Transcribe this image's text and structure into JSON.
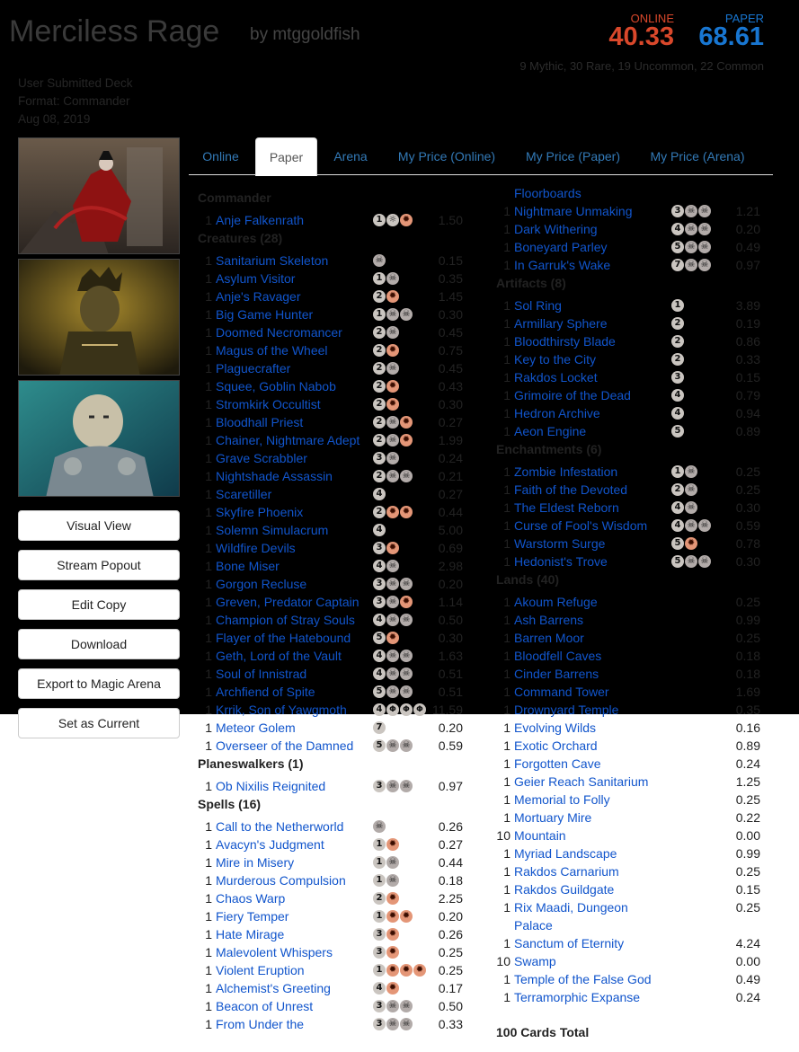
{
  "deck": {
    "title": "Merciless Rage",
    "byline": "by mtggoldfish",
    "submitted": "User Submitted Deck",
    "format": "Format: Commander",
    "date": "Aug 08, 2019"
  },
  "prices": {
    "online_label": "ONLINE",
    "online_value": "40.33",
    "paper_label": "PAPER",
    "paper_value": "68.61",
    "counts": "9 Mythic, 30 Rare, 19 Uncommon, 22 Common"
  },
  "colors": {
    "online": "#d9482b",
    "paper": "#1876d1",
    "link": "#1155cc",
    "white_pip": "#cac5c0",
    "black_pip": "#b2aba9",
    "red_pip": "#e49677"
  },
  "buttons": [
    "Visual View",
    "Stream Popout",
    "Edit Copy",
    "Download",
    "Export to Magic Arena",
    "Set as Current"
  ],
  "tabs": [
    "Online",
    "Paper",
    "Arena",
    "My Price (Online)",
    "My Price (Paper)",
    "My Price (Arena)"
  ],
  "active_tab": "Paper",
  "left": [
    {
      "sec": "Commander"
    },
    {
      "q": "1",
      "n": "Anje Falkenrath",
      "m": "1WR",
      "p": "1.50"
    },
    {
      "sec": "Creatures (28)"
    },
    {
      "q": "1",
      "n": "Sanitarium Skeleton",
      "m": "B",
      "p": "0.15"
    },
    {
      "q": "1",
      "n": "Asylum Visitor",
      "m": "1B",
      "p": "0.35"
    },
    {
      "q": "1",
      "n": "Anje's Ravager",
      "m": "2R",
      "p": "1.45"
    },
    {
      "q": "1",
      "n": "Big Game Hunter",
      "m": "1BB",
      "p": "0.30"
    },
    {
      "q": "1",
      "n": "Doomed Necromancer",
      "m": "2B",
      "p": "0.45"
    },
    {
      "q": "1",
      "n": "Magus of the Wheel",
      "m": "2R",
      "p": "0.75"
    },
    {
      "q": "1",
      "n": "Plaguecrafter",
      "m": "2B",
      "p": "0.45"
    },
    {
      "q": "1",
      "n": "Squee, Goblin Nabob",
      "m": "2R",
      "p": "0.43"
    },
    {
      "q": "1",
      "n": "Stromkirk Occultist",
      "m": "2R",
      "p": "0.30"
    },
    {
      "q": "1",
      "n": "Bloodhall Priest",
      "m": "2BR",
      "p": "0.27"
    },
    {
      "q": "1",
      "n": "Chainer, Nightmare Adept",
      "m": "2BR",
      "p": "1.99"
    },
    {
      "q": "1",
      "n": "Grave Scrabbler",
      "m": "3B",
      "p": "0.24"
    },
    {
      "q": "1",
      "n": "Nightshade Assassin",
      "m": "2BB",
      "p": "0.21"
    },
    {
      "q": "1",
      "n": "Scaretiller",
      "m": "4",
      "p": "0.27"
    },
    {
      "q": "1",
      "n": "Skyfire Phoenix",
      "m": "2RR",
      "p": "0.44"
    },
    {
      "q": "1",
      "n": "Solemn Simulacrum",
      "m": "4",
      "p": "5.00"
    },
    {
      "q": "1",
      "n": "Wildfire Devils",
      "m": "3R",
      "p": "0.69"
    },
    {
      "q": "1",
      "n": "Bone Miser",
      "m": "4B",
      "p": "2.98"
    },
    {
      "q": "1",
      "n": "Gorgon Recluse",
      "m": "3BB",
      "p": "0.20"
    },
    {
      "q": "1",
      "n": "Greven, Predator Captain",
      "m": "3BR",
      "p": "1.14"
    },
    {
      "q": "1",
      "n": "Champion of Stray Souls",
      "m": "4BB",
      "p": "0.50"
    },
    {
      "q": "1",
      "n": "Flayer of the Hatebound",
      "m": "5R",
      "p": "0.30"
    },
    {
      "q": "1",
      "n": "Geth, Lord of the Vault",
      "m": "4BB",
      "p": "1.63"
    },
    {
      "q": "1",
      "n": "Soul of Innistrad",
      "m": "4BB",
      "p": "0.51"
    },
    {
      "q": "1",
      "n": "Archfiend of Spite",
      "m": "5BB",
      "p": "0.51"
    },
    {
      "q": "1",
      "n": "Krrik, Son of Yawgmoth",
      "m": "4ΦΦΦ",
      "p": "11.59"
    },
    {
      "q": "1",
      "n": "Meteor Golem",
      "m": "7",
      "p": "0.20"
    },
    {
      "q": "1",
      "n": "Overseer of the Damned",
      "m": "5BB",
      "p": "0.59"
    },
    {
      "sec": "Planeswalkers (1)"
    },
    {
      "q": "1",
      "n": "Ob Nixilis Reignited",
      "m": "3BB",
      "p": "0.97"
    },
    {
      "sec": "Spells (16)"
    },
    {
      "q": "1",
      "n": "Call to the Netherworld",
      "m": "B",
      "p": "0.26"
    },
    {
      "q": "1",
      "n": "Avacyn's Judgment",
      "m": "1R",
      "p": "0.27"
    },
    {
      "q": "1",
      "n": "Mire in Misery",
      "m": "1B",
      "p": "0.44"
    },
    {
      "q": "1",
      "n": "Murderous Compulsion",
      "m": "1B",
      "p": "0.18"
    },
    {
      "q": "1",
      "n": "Chaos Warp",
      "m": "2R",
      "p": "2.25"
    },
    {
      "q": "1",
      "n": "Fiery Temper",
      "m": "1RR",
      "p": "0.20"
    },
    {
      "q": "1",
      "n": "Hate Mirage",
      "m": "3R",
      "p": "0.26"
    },
    {
      "q": "1",
      "n": "Malevolent Whispers",
      "m": "3R",
      "p": "0.25"
    },
    {
      "q": "1",
      "n": "Violent Eruption",
      "m": "1RRR",
      "p": "0.25"
    },
    {
      "q": "1",
      "n": "Alchemist's Greeting",
      "m": "4R",
      "p": "0.17"
    },
    {
      "q": "1",
      "n": "Beacon of Unrest",
      "m": "3BB",
      "p": "0.50"
    },
    {
      "q": "1",
      "n": "From Under the",
      "m": "3BB",
      "p": "0.33"
    }
  ],
  "right": [
    {
      "q": "",
      "n": "Floorboards",
      "m": "",
      "p": ""
    },
    {
      "q": "1",
      "n": "Nightmare Unmaking",
      "m": "3BB",
      "p": "1.21"
    },
    {
      "q": "1",
      "n": "Dark Withering",
      "m": "4BB",
      "p": "0.20"
    },
    {
      "q": "1",
      "n": "Boneyard Parley",
      "m": "5BB",
      "p": "0.49"
    },
    {
      "q": "1",
      "n": "In Garruk's Wake",
      "m": "7BB",
      "p": "0.97"
    },
    {
      "sec": "Artifacts (8)"
    },
    {
      "q": "1",
      "n": "Sol Ring",
      "m": "1",
      "p": "3.89"
    },
    {
      "q": "1",
      "n": "Armillary Sphere",
      "m": "2",
      "p": "0.19"
    },
    {
      "q": "1",
      "n": "Bloodthirsty Blade",
      "m": "2",
      "p": "0.86"
    },
    {
      "q": "1",
      "n": "Key to the City",
      "m": "2",
      "p": "0.33"
    },
    {
      "q": "1",
      "n": "Rakdos Locket",
      "m": "3",
      "p": "0.15"
    },
    {
      "q": "1",
      "n": "Grimoire of the Dead",
      "m": "4",
      "p": "0.79"
    },
    {
      "q": "1",
      "n": "Hedron Archive",
      "m": "4",
      "p": "0.94"
    },
    {
      "q": "1",
      "n": "Aeon Engine",
      "m": "5",
      "p": "0.89"
    },
    {
      "sec": "Enchantments (6)"
    },
    {
      "q": "1",
      "n": "Zombie Infestation",
      "m": "1B",
      "p": "0.25"
    },
    {
      "q": "1",
      "n": "Faith of the Devoted",
      "m": "2B",
      "p": "0.25"
    },
    {
      "q": "1",
      "n": "The Eldest Reborn",
      "m": "4B",
      "p": "0.30"
    },
    {
      "q": "1",
      "n": "Curse of Fool's Wisdom",
      "m": "4BB",
      "p": "0.59"
    },
    {
      "q": "1",
      "n": "Warstorm Surge",
      "m": "5R",
      "p": "0.78"
    },
    {
      "q": "1",
      "n": "Hedonist's Trove",
      "m": "5BB",
      "p": "0.30"
    },
    {
      "sec": "Lands (40)"
    },
    {
      "q": "1",
      "n": "Akoum Refuge",
      "m": "",
      "p": "0.25"
    },
    {
      "q": "1",
      "n": "Ash Barrens",
      "m": "",
      "p": "0.99"
    },
    {
      "q": "1",
      "n": "Barren Moor",
      "m": "",
      "p": "0.25"
    },
    {
      "q": "1",
      "n": "Bloodfell Caves",
      "m": "",
      "p": "0.18"
    },
    {
      "q": "1",
      "n": "Cinder Barrens",
      "m": "",
      "p": "0.18"
    },
    {
      "q": "1",
      "n": "Command Tower",
      "m": "",
      "p": "1.69"
    },
    {
      "q": "1",
      "n": "Drownyard Temple",
      "m": "",
      "p": "0.35"
    },
    {
      "q": "1",
      "n": "Evolving Wilds",
      "m": "",
      "p": "0.16"
    },
    {
      "q": "1",
      "n": "Exotic Orchard",
      "m": "",
      "p": "0.89"
    },
    {
      "q": "1",
      "n": "Forgotten Cave",
      "m": "",
      "p": "0.24"
    },
    {
      "q": "1",
      "n": "Geier Reach Sanitarium",
      "m": "",
      "p": "1.25"
    },
    {
      "q": "1",
      "n": "Memorial to Folly",
      "m": "",
      "p": "0.25"
    },
    {
      "q": "1",
      "n": "Mortuary Mire",
      "m": "",
      "p": "0.22"
    },
    {
      "q": "10",
      "n": "Mountain",
      "m": "",
      "p": "0.00"
    },
    {
      "q": "1",
      "n": "Myriad Landscape",
      "m": "",
      "p": "0.99"
    },
    {
      "q": "1",
      "n": "Rakdos Carnarium",
      "m": "",
      "p": "0.25"
    },
    {
      "q": "1",
      "n": "Rakdos Guildgate",
      "m": "",
      "p": "0.15"
    },
    {
      "q": "1",
      "n": "Rix Maadi, Dungeon",
      "n2": "Palace",
      "m": "",
      "p": "0.25"
    },
    {
      "q": "1",
      "n": "Sanctum of Eternity",
      "m": "",
      "p": "4.24"
    },
    {
      "q": "10",
      "n": "Swamp",
      "m": "",
      "p": "0.00"
    },
    {
      "q": "1",
      "n": "Temple of the False God",
      "m": "",
      "p": "0.49"
    },
    {
      "q": "1",
      "n": "Terramorphic Expanse",
      "m": "",
      "p": "0.24"
    }
  ],
  "total": "100 Cards Total"
}
